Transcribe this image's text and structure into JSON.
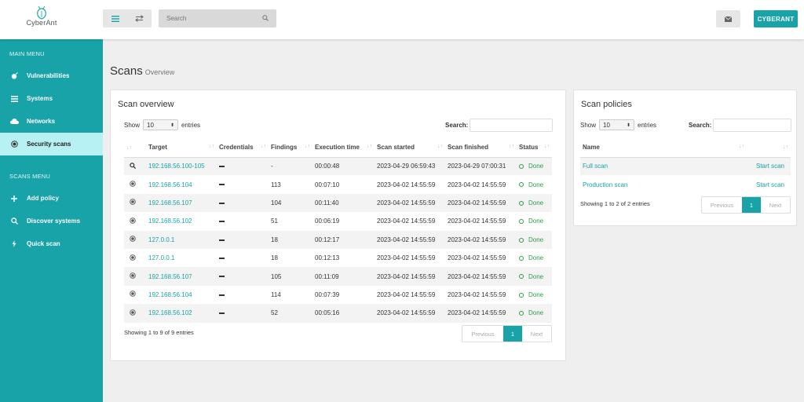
{
  "header": {
    "logo_text": "CyberAnt",
    "search_placeholder": "Search",
    "user_button": "CYBERANT",
    "icons": [
      "menu-icon",
      "swap-icon",
      "search-icon",
      "mail-icon"
    ]
  },
  "sidebar": {
    "main_menu_heading": "MAIN MENU",
    "main_items": [
      {
        "label": "Vulnerabilities",
        "icon": "bug-icon"
      },
      {
        "label": "Systems",
        "icon": "list-icon"
      },
      {
        "label": "Networks",
        "icon": "cloud-icon"
      },
      {
        "label": "Security scans",
        "icon": "target-icon",
        "active": true
      }
    ],
    "scans_menu_heading": "SCANS MENU",
    "scan_items": [
      {
        "label": "Add policy",
        "icon": "plus-icon"
      },
      {
        "label": "Discover systems",
        "icon": "search-icon"
      },
      {
        "label": "Quick scan",
        "icon": "bolt-icon"
      }
    ]
  },
  "page": {
    "title": "Scans",
    "subtitle": "Overview"
  },
  "scan_overview": {
    "title": "Scan overview",
    "show_label": "Show",
    "show_value": "10",
    "entries_label": "entries",
    "search_label": "Search:",
    "columns": [
      "",
      "Target",
      "Credentials",
      "Findings",
      "Execution time",
      "Scan started",
      "Scan finished",
      "Status"
    ],
    "rows": [
      {
        "icon": "search",
        "target": "192.168.56.100-105",
        "findings": "-",
        "exec": "00:00:48",
        "started": "2023-04-29 06:59:43",
        "finished": "2023-04-29 07:00:31",
        "status": "Done"
      },
      {
        "icon": "target",
        "target": "192.168.56.104",
        "findings": "113",
        "exec": "00:07:10",
        "started": "2023-04-02 14:55:59",
        "finished": "2023-04-02 14:55:59",
        "status": "Done"
      },
      {
        "icon": "target",
        "target": "192.168.56.107",
        "findings": "104",
        "exec": "00:11:40",
        "started": "2023-04-02 14:55:59",
        "finished": "2023-04-02 14:55:59",
        "status": "Done"
      },
      {
        "icon": "target",
        "target": "192.168.56.102",
        "findings": "51",
        "exec": "00:06:19",
        "started": "2023-04-02 14:55:59",
        "finished": "2023-04-02 14:55:59",
        "status": "Done"
      },
      {
        "icon": "target",
        "target": "127.0.0.1",
        "findings": "18",
        "exec": "00:12:17",
        "started": "2023-04-02 14:55:59",
        "finished": "2023-04-02 14:55:59",
        "status": "Done"
      },
      {
        "icon": "target",
        "target": "127.0.0.1",
        "findings": "18",
        "exec": "00:12:13",
        "started": "2023-04-02 14:55:59",
        "finished": "2023-04-02 14:55:59",
        "status": "Done"
      },
      {
        "icon": "target",
        "target": "192.168.56.107",
        "findings": "105",
        "exec": "00:11:09",
        "started": "2023-04-02 14:55:59",
        "finished": "2023-04-02 14:55:59",
        "status": "Done"
      },
      {
        "icon": "target",
        "target": "192.168.56.104",
        "findings": "114",
        "exec": "00:07:39",
        "started": "2023-04-02 14:55:59",
        "finished": "2023-04-02 14:55:59",
        "status": "Done"
      },
      {
        "icon": "target",
        "target": "192.168.56.102",
        "findings": "52",
        "exec": "00:05:16",
        "started": "2023-04-02 14:55:59",
        "finished": "2023-04-02 14:55:59",
        "status": "Done"
      }
    ],
    "info": "Showing 1 to 9 of 9 entries",
    "pager": {
      "previous": "Previous",
      "current": "1",
      "next": "Next"
    }
  },
  "scan_policies": {
    "title": "Scan policies",
    "show_label": "Show",
    "show_value": "10",
    "entries_label": "entries",
    "search_label": "Search:",
    "columns": [
      "Name",
      ""
    ],
    "rows": [
      {
        "name": "Full scan",
        "action": "Start scan"
      },
      {
        "name": "Production scan",
        "action": "Start scan"
      }
    ],
    "info": "Showing 1 to 2 of 2 entries",
    "pager": {
      "previous": "Previous",
      "current": "1",
      "next": "Next"
    }
  },
  "colors": {
    "accent": "#17a3a8",
    "active_bg": "#b8f1f3",
    "done": "#2d9d4b"
  }
}
